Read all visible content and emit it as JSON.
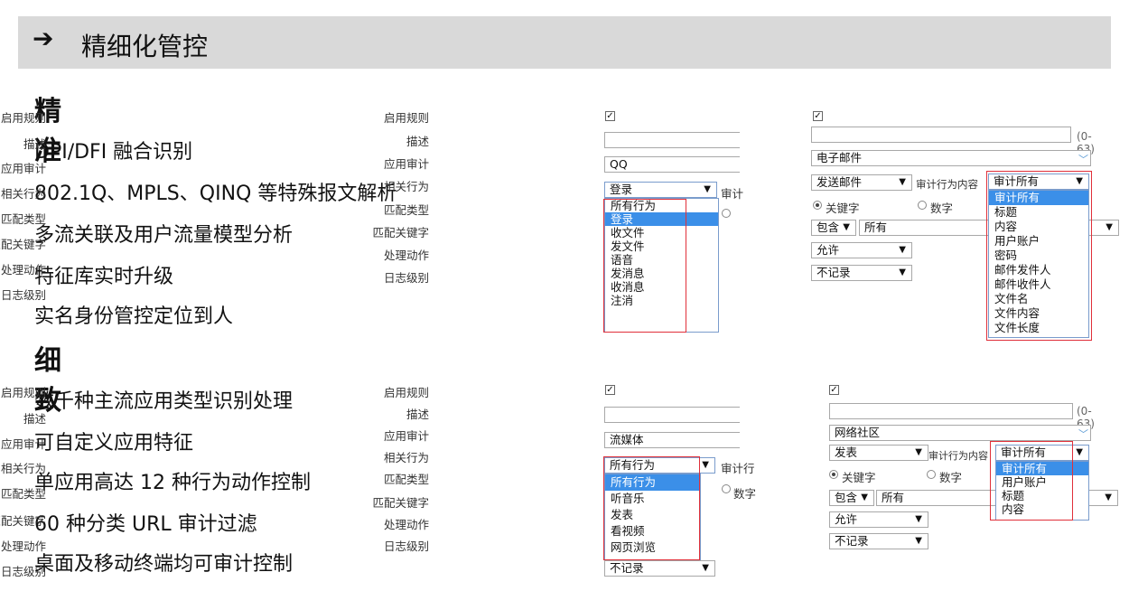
{
  "header": {
    "title": "精细化管控",
    "arrow": "➔"
  },
  "sections": [
    {
      "heading": "精准",
      "items": [
        "DPI/DFI 融合识别",
        "802.1Q、MPLS、QINQ 等特殊报文解析",
        "多流关联及用户流量模型分析",
        "特征库实时升级",
        "实名身份管控定位到人"
      ]
    },
    {
      "heading": "细致",
      "items": [
        "数千种主流应用类型识别处理",
        "可自定义应用特征",
        "单应用高达 12 种行为动作控制",
        "60 种分类 URL 审计过滤",
        "桌面及移动终端均可审计控制"
      ]
    }
  ],
  "labels": {
    "enable": "启用规则",
    "desc": "描述",
    "app": "应用审计",
    "action": "相关行为",
    "match_type": "匹配类型",
    "match_kw": "匹配关键字",
    "handle": "处理动作",
    "log": "日志级别",
    "audit_content": "审计行为内容",
    "audit_short": "审计",
    "audit_short2": "审计行",
    "keyword": "关键字",
    "number": "数字",
    "include": "包含",
    "all": "所有",
    "allow": "允许",
    "no_log": "不记录",
    "range": "(0-63)"
  },
  "p1": {
    "app_value": "QQ",
    "action_value": "登录",
    "options": [
      "所有行为",
      "登录",
      "收文件",
      "发文件",
      "语音",
      "发消息",
      "收消息",
      "注消"
    ],
    "selected": 1
  },
  "p2": {
    "app_value": "电子邮件",
    "action_value": "发送邮件",
    "audit_value": "审计所有",
    "options": [
      "审计所有",
      "标题",
      "内容",
      "用户账户",
      "密码",
      "邮件发件人",
      "邮件收件人",
      "文件名",
      "文件内容",
      "文件长度"
    ],
    "selected": 0
  },
  "p3": {
    "app_value": "流媒体",
    "action_value": "所有行为",
    "options": [
      "所有行为",
      "听音乐",
      "发表",
      "看视频",
      "网页浏览"
    ],
    "selected": 0
  },
  "p4": {
    "app_value": "网络社区",
    "action_value": "发表",
    "audit_value": "审计所有",
    "options": [
      "审计所有",
      "用户账户",
      "标题",
      "内容"
    ],
    "selected": 0
  },
  "colors": {
    "highlight": "#3b8fe8",
    "red": "#e0303a",
    "header_bg": "#d9d9d9"
  }
}
